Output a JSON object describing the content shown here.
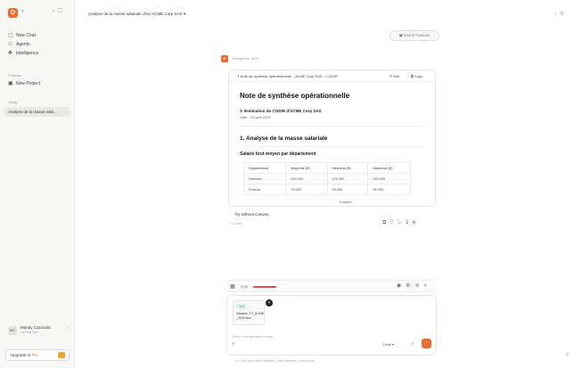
{
  "sidebar": {
    "logo": "D",
    "nav": [
      {
        "label": "New Chat",
        "icon": "chat-icon"
      },
      {
        "label": "Agents",
        "icon": "agents-icon"
      },
      {
        "label": "Intelligence",
        "icon": "intelligence-icon"
      }
    ],
    "projects_label": "Projects",
    "new_project": "New Project",
    "recent_label": "Today",
    "chat_item": "Analyse de la masse sala...",
    "user": {
      "initials": "MC",
      "name": "Mandy Cazzuola",
      "plan": "La Free Tier"
    },
    "upgrade": {
      "prefix": "Upgrade to ",
      "pro": "Pro"
    }
  },
  "header": {
    "conversation_title": "Analyse de la masse salariale chez ACME Corp SAS",
    "canvas_button": "Use in Canvas"
  },
  "assistant": {
    "avatar": "D",
    "name": "Thought for 3s"
  },
  "document": {
    "header_title": "Note de synthèse opérationnelle – ACME Corp SAS – CODIR",
    "edit_label": "Edit",
    "copy_label": "Copy",
    "title": "Note de synthèse opérationnelle",
    "recipient": "À destination du CODIR d'ACME Corp SAS",
    "date": "Date : 15 avril 2025",
    "section1": "1. Analyse de la masse salariale",
    "subsection": "Salaire brut moyen par département",
    "table": {
      "headers": [
        "Département",
        "Moyenne (€)",
        "Minimum (€)",
        "Maximum (€)"
      ],
      "rows": [
        [
          "Direction",
          "150 000",
          "120 000",
          "220 000"
        ],
        [
          "Finance",
          "70 000",
          "55 000",
          "95 000"
        ]
      ]
    },
    "page_collapse": "Expand"
  },
  "message": {
    "try_canvas": "Try without Canvas",
    "sub": "Le Chat"
  },
  "audio": {
    "time": "0:00"
  },
  "composer": {
    "file_tag": "XLS",
    "file_name": "Salaires_FY_ACME_2025.xlsx",
    "placeholder": "Posez-moi quelque chose",
    "model": "Think"
  },
  "footer_note": "Le Chat can make mistakes. Check answers. Learn more."
}
